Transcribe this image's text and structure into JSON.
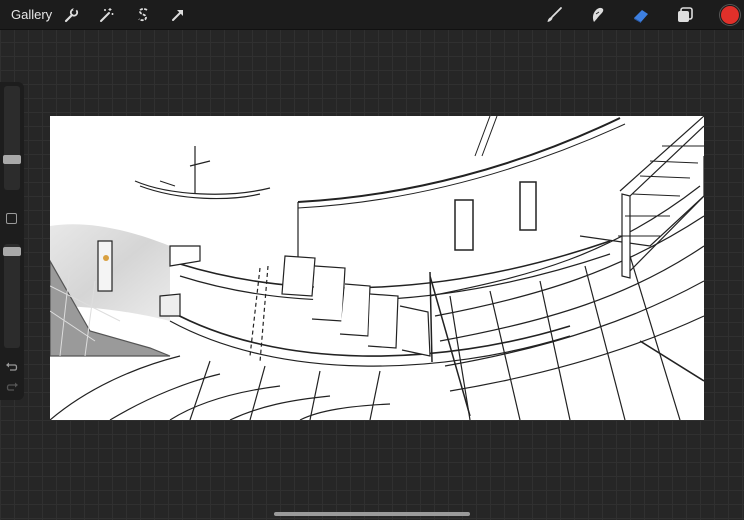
{
  "toolbar": {
    "gallery_label": "Gallery",
    "left_icons": [
      "wrench-icon",
      "magic-wand-icon",
      "selection-icon",
      "transform-arrow-icon"
    ],
    "right_icons": [
      "brush-icon",
      "smudge-icon",
      "eraser-icon",
      "layers-icon"
    ],
    "eraser_active_color": "#3d7fe0",
    "current_color": "#e0302a"
  },
  "sidebar": {
    "brush_size_level": 0.55,
    "opacity_level": 0.9,
    "modify_button_icon": "square-icon",
    "undo_icon": "undo-arrow-icon",
    "redo_icon": "redo-arrow-icon"
  },
  "canvas": {
    "content": "architectural-sketch"
  }
}
